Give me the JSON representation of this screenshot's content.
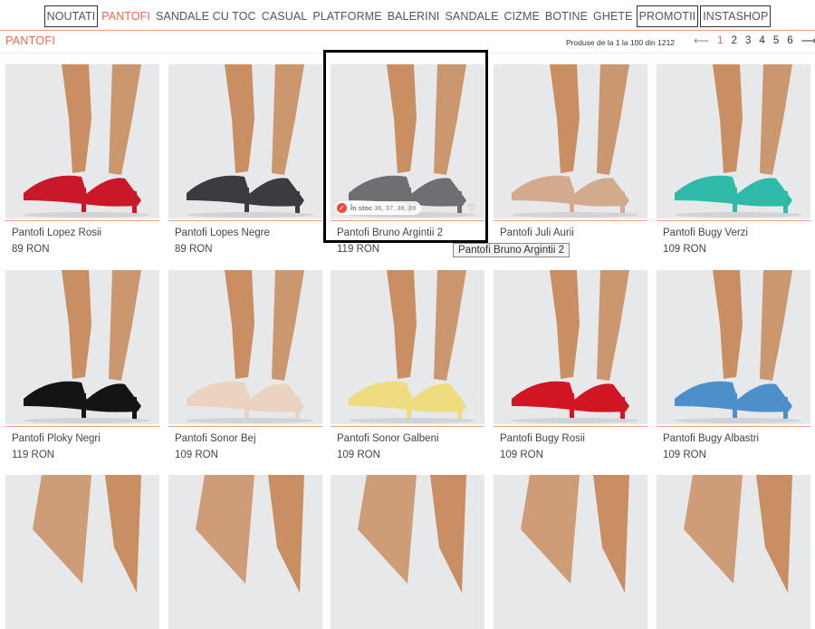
{
  "nav": {
    "items": [
      {
        "label": "NOUTATI",
        "boxed": true,
        "active": false
      },
      {
        "label": "PANTOFI",
        "boxed": false,
        "active": true
      },
      {
        "label": "SANDALE CU TOC",
        "boxed": false,
        "active": false
      },
      {
        "label": "CASUAL",
        "boxed": false,
        "active": false
      },
      {
        "label": "PLATFORME",
        "boxed": false,
        "active": false
      },
      {
        "label": "BALERINI",
        "boxed": false,
        "active": false
      },
      {
        "label": "SANDALE",
        "boxed": false,
        "active": false
      },
      {
        "label": "CIZME",
        "boxed": false,
        "active": false
      },
      {
        "label": "BOTINE",
        "boxed": false,
        "active": false
      },
      {
        "label": "GHETE",
        "boxed": false,
        "active": false
      },
      {
        "label": "PROMOTII",
        "boxed": true,
        "active": false
      },
      {
        "label": "INSTASHOP",
        "boxed": true,
        "active": false
      }
    ]
  },
  "header": {
    "category_title": "PANTOFI",
    "count_text": "Produse de la 1 la 100 din 1212",
    "pager": {
      "prev": "⟵",
      "pages": [
        "1",
        "2",
        "3",
        "4",
        "5",
        "6"
      ],
      "current": "1",
      "next": "⟶"
    }
  },
  "colors": {
    "accent": "#e8684e",
    "rule": "#ef9c8c",
    "photo_bg": "#e7e8ea",
    "skin": "#c98f63"
  },
  "products": [
    {
      "name": "Pantofi Lopez Rosii",
      "price": "89 RON",
      "shoe_color": "#c8182a"
    },
    {
      "name": "Pantofi Lopes Negre",
      "price": "89 RON",
      "shoe_color": "#3a3c40"
    },
    {
      "name": "Pantofi Bruno Argintii 2",
      "price": "119 RON",
      "shoe_color": "#6f6e72"
    },
    {
      "name": "Pantofi Juli Aurii",
      "price": "",
      "shoe_color": "#d2ab8e"
    },
    {
      "name": "Pantofi Bugy Verzi",
      "price": "109 RON",
      "shoe_color": "#2fb9a9"
    },
    {
      "name": "Pantofi Ploky Negri",
      "price": "119 RON",
      "shoe_color": "#141414"
    },
    {
      "name": "Pantofi Sonor Bej",
      "price": "109 RON",
      "shoe_color": "#ead3bf"
    },
    {
      "name": "Pantofi Sonor Galbeni",
      "price": "109 RON",
      "shoe_color": "#eedc7e"
    },
    {
      "name": "Pantofi Bugy Rosii",
      "price": "109 RON",
      "shoe_color": "#d11522"
    },
    {
      "name": "Pantofi Bugy Albastri",
      "price": "109 RON",
      "shoe_color": "#4d8fca"
    },
    {
      "name": "",
      "price": "",
      "shoe_color": "#c98f63"
    },
    {
      "name": "",
      "price": "",
      "shoe_color": "#c98f63"
    },
    {
      "name": "",
      "price": "",
      "shoe_color": "#c98f63"
    },
    {
      "name": "",
      "price": "",
      "shoe_color": "#c98f63"
    },
    {
      "name": "",
      "price": "",
      "shoe_color": "#c98f63"
    }
  ],
  "hover": {
    "stock_label": "În stoc",
    "sizes": "36, 37, 38, 39",
    "check_icon": "check-circle-icon",
    "heart_icon": "heart-outline-icon",
    "tooltip": "Pantofi Bruno Argintii 2"
  }
}
